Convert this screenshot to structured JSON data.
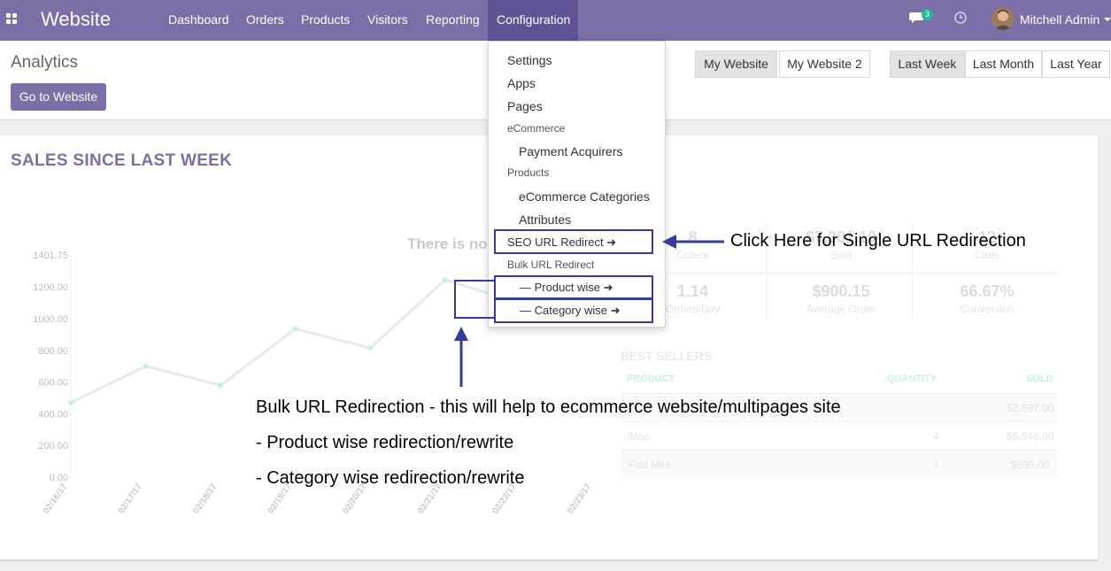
{
  "navbar": {
    "brand": "Website",
    "menu": [
      "Dashboard",
      "Orders",
      "Products",
      "Visitors",
      "Reporting",
      "Configuration"
    ],
    "messages_count": "3",
    "user_name": "Mitchell Admin"
  },
  "control_panel": {
    "title": "Analytics",
    "go_button": "Go to Website",
    "website_filters": [
      "My Website",
      "My Website 2"
    ],
    "period_filters": [
      "Last Week",
      "Last Month",
      "Last Year"
    ]
  },
  "dashboard": {
    "sales_title": "SALES SINCE LAST WEEK",
    "no_data_text": "There is no",
    "stats": [
      {
        "value": "8",
        "label": "Orders"
      },
      {
        "value": "$7,201.10",
        "label": "Sold"
      },
      {
        "value": "12",
        "label": "Carts"
      },
      {
        "value": "1.14",
        "label": "Orders/Day"
      },
      {
        "value": "$900.15",
        "label": "Average Order"
      },
      {
        "value": "66.67%",
        "label": "Conversion"
      }
    ],
    "best_sellers": {
      "title": "BEST SELLERS",
      "columns": [
        "PRODUCT",
        "QUANTITY",
        "SOLD"
      ],
      "rows": [
        {
          "product": "",
          "quantity": "",
          "sold": "$2,697.00"
        },
        {
          "product": "iMac",
          "quantity": "4",
          "sold": "$5,946.00"
        },
        {
          "product": "iPad Mini",
          "quantity": "1",
          "sold": "$599.00"
        }
      ]
    }
  },
  "chart_data": {
    "type": "line",
    "x": [
      "02/16/17",
      "02/17/17",
      "02/18/17",
      "02/19/17",
      "02/20/17",
      "02/21/17",
      "02/22/17",
      "02/23/17"
    ],
    "y": [
      470,
      700,
      580,
      935,
      815,
      1245,
      1100,
      null
    ],
    "yticks": [
      "1401.75",
      "1200.00",
      "1000.00",
      "800.00",
      "600.00",
      "400.00",
      "200.00",
      "0.00"
    ],
    "ylim": [
      0,
      1401.75
    ],
    "colors": {
      "line": "#e6ebe9",
      "point": "#c6f0e3"
    }
  },
  "configuration_menu": {
    "items": [
      {
        "type": "item",
        "label": "Settings"
      },
      {
        "type": "item",
        "label": "Apps"
      },
      {
        "type": "item",
        "label": "Pages"
      },
      {
        "type": "header",
        "label": "eCommerce"
      },
      {
        "type": "subitem",
        "label": "Payment Acquirers"
      },
      {
        "type": "header",
        "label": "Products"
      },
      {
        "type": "subitem",
        "label": "eCommerce Categories"
      },
      {
        "type": "subitem",
        "label": "Attributes"
      },
      {
        "type": "item",
        "label": "SEO URL Redirect ➜"
      },
      {
        "type": "header",
        "label": "Bulk URL Redirect"
      },
      {
        "type": "subitem",
        "label": "— Product wise ➜"
      },
      {
        "type": "subitem",
        "label": "— Category wise ➜"
      }
    ]
  },
  "annotations": {
    "single": "Click Here for Single URL Redirection",
    "bulk_title": "Bulk URL Redirection - this will help to ecommerce website/multipages site",
    "bulk_product": "- Product wise redirection/rewrite",
    "bulk_category": "- Category wise redirection/rewrite",
    "color": "#3a3a9e"
  }
}
